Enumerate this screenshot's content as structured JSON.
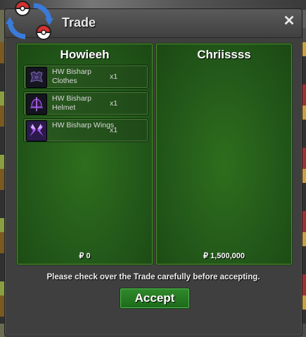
{
  "window": {
    "title": "Trade",
    "close_glyph": "✕"
  },
  "left_panel": {
    "player_name": "Howieeh",
    "money": "₽ 0",
    "items": [
      {
        "name": "HW Bisharp Clothes",
        "qty": "x1",
        "icon": "clothes-icon"
      },
      {
        "name": "HW Bisharp Helmet",
        "qty": "x1",
        "icon": "helmet-icon"
      },
      {
        "name": "HW Bisharp Wings",
        "qty": "x1",
        "icon": "wings-icon"
      }
    ]
  },
  "right_panel": {
    "player_name": "Chriissss",
    "money": "₽ 1,500,000",
    "items": []
  },
  "notice": "Please check over the Trade carefully before accepting.",
  "accept_label": "Accept",
  "colors": {
    "panel_green": "#23591a",
    "window_bg": "#3f3f3f",
    "accept_green": "#2f8a2a",
    "item_purple": "#a855f7"
  }
}
